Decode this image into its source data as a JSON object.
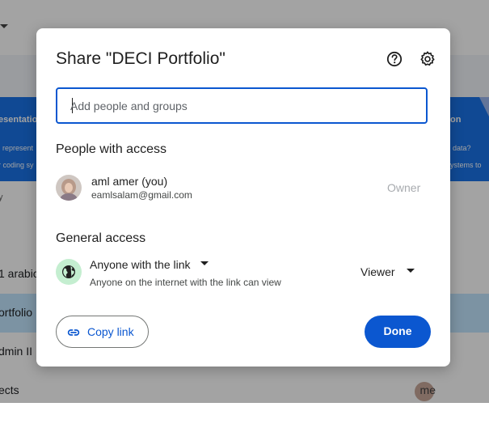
{
  "background": {
    "banner_left_title": "esentatio",
    "banner_left_line1": "represent",
    "banner_left_line2": "r coding sy",
    "banner_right_title": "on",
    "banner_right_line1": "data?",
    "banner_right_line2": "ystems to",
    "sort_label": "y",
    "rows": [
      {
        "label": "1 arabic"
      },
      {
        "label": "ortfolio"
      },
      {
        "label": "dmin II"
      },
      {
        "label": "ects"
      }
    ],
    "owner_me": "me"
  },
  "dialog": {
    "title": "Share \"DECI Portfolio\"",
    "add_people_placeholder": "Add people and groups",
    "people_section": "People with access",
    "user": {
      "name": "aml amer (you)",
      "email": "eamlsalam@gmail.com",
      "role": "Owner"
    },
    "general_section": "General access",
    "access_option": "Anyone with the link",
    "access_description": "Anyone on the internet with the link can view",
    "role_option": "Viewer",
    "copy_link_label": "Copy link",
    "done_label": "Done"
  },
  "colors": {
    "primary": "#0b57d0",
    "globe_bg": "#c4eed0",
    "scrim": "rgba(0,0,0,0.36)"
  },
  "icons": [
    "help-icon",
    "gear-icon",
    "globe-icon",
    "link-icon",
    "avatar",
    "add-person-icon"
  ]
}
